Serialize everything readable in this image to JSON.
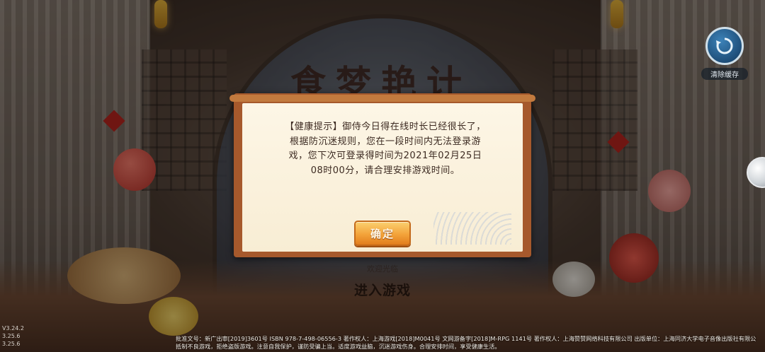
{
  "background": {
    "banner_text": "食梦艳计"
  },
  "clear_cache": {
    "icon": "refresh-cycle-icon",
    "label": "清除缓存"
  },
  "dialog": {
    "message": "【健康提示】御侍今日得在线时长已经很长了，根据防沉迷规则，您在一段时间内无法登录游戏，您下次可登录得时间为2021年02月25日08时00分，请合理安排游戏时间。",
    "confirm_label": "确定",
    "accent_color": "#f3a33a"
  },
  "enter_game": {
    "faded_label": "欢迎光临",
    "label": "进入游戏"
  },
  "versions": [
    "V3.24.2",
    "3.25.6",
    "3.25.6"
  ],
  "legal": {
    "line1": "批准文号：新广出审[2019]3601号 ISBN 978-7-498-06556-3 著作权人：上海游戏[2018]M0041号 文网游备字[2018]M-RPG 1141号 著作权人：上海赞赞网络科技有限公司 出版单位：上海同济大学电子音像出版社有限公司",
    "line2": "抵制不良游戏，拒绝盗版游戏。注意自我保护，谨防受骗上当。适度游戏益脑，沉迷游戏伤身。合理安排时间，享受健康生活。"
  }
}
